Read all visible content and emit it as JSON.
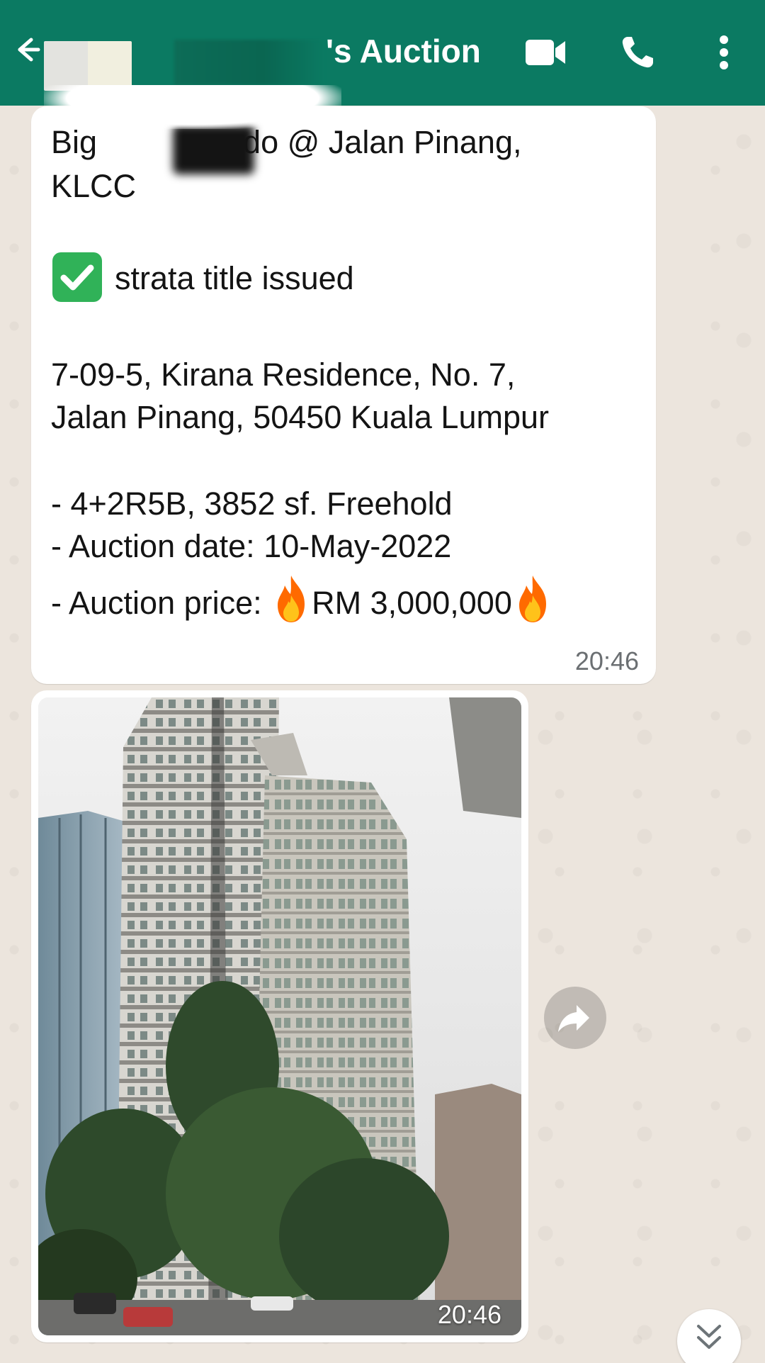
{
  "header": {
    "title": "'s Auction",
    "bg_color": "#0b7a62"
  },
  "message": {
    "line1": "Big",
    "line1b": "do @ Jalan Pinang,",
    "line2": "KLCC",
    "check_text": "strata title issued",
    "address1": "7-09-5, Kirana Residence, No. 7,",
    "address2": "Jalan Pinang, 50450 Kuala Lumpur",
    "detail1": "- 4+2R5B, 3852 sf. Freehold",
    "detail2": "- Auction date: 10-May-2022",
    "detail3_prefix": "- Auction price:",
    "price": "RM 3,000,000",
    "time": "20:46"
  },
  "image_message": {
    "time": "20:46",
    "alt_subject": "photo of high-rise residential towers"
  },
  "icons": {
    "back": "arrow-left-icon",
    "video": "video-camera-icon",
    "call": "phone-icon",
    "more": "more-vertical-icon",
    "check": "check-mark-icon",
    "fire": "fire-emoji-icon",
    "forward": "forward-arrow-icon",
    "scroll": "double-chevron-down-icon"
  }
}
